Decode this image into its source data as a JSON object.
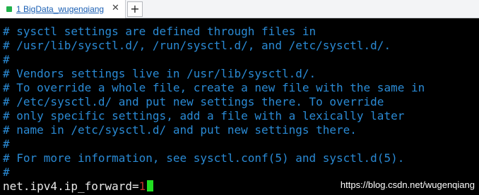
{
  "tab": {
    "label": "1 BigData_wugenqiang",
    "close_symbol": "✕",
    "status_color": "#22b14c"
  },
  "new_tab": {
    "symbol": "+"
  },
  "terminal": {
    "comment_color": "#2a8ad4",
    "lines": [
      "# sysctl settings are defined through files in",
      "# /usr/lib/sysctl.d/, /run/sysctl.d/, and /etc/sysctl.d/.",
      "#",
      "# Vendors settings live in /usr/lib/sysctl.d/.",
      "# To override a whole file, create a new file with the same in",
      "# /etc/sysctl.d/ and put new settings there. To override",
      "# only specific settings, add a file with a lexically later",
      "# name in /etc/sysctl.d/ and put new settings there.",
      "#",
      "# For more information, see sysctl.conf(5) and sysctl.d(5).",
      "#"
    ],
    "setting": {
      "key": "net.ipv4.ip_forward=",
      "value": "1"
    },
    "cursor_color": "#21e021"
  },
  "watermark": "https://blog.csdn.net/wugenqiang"
}
